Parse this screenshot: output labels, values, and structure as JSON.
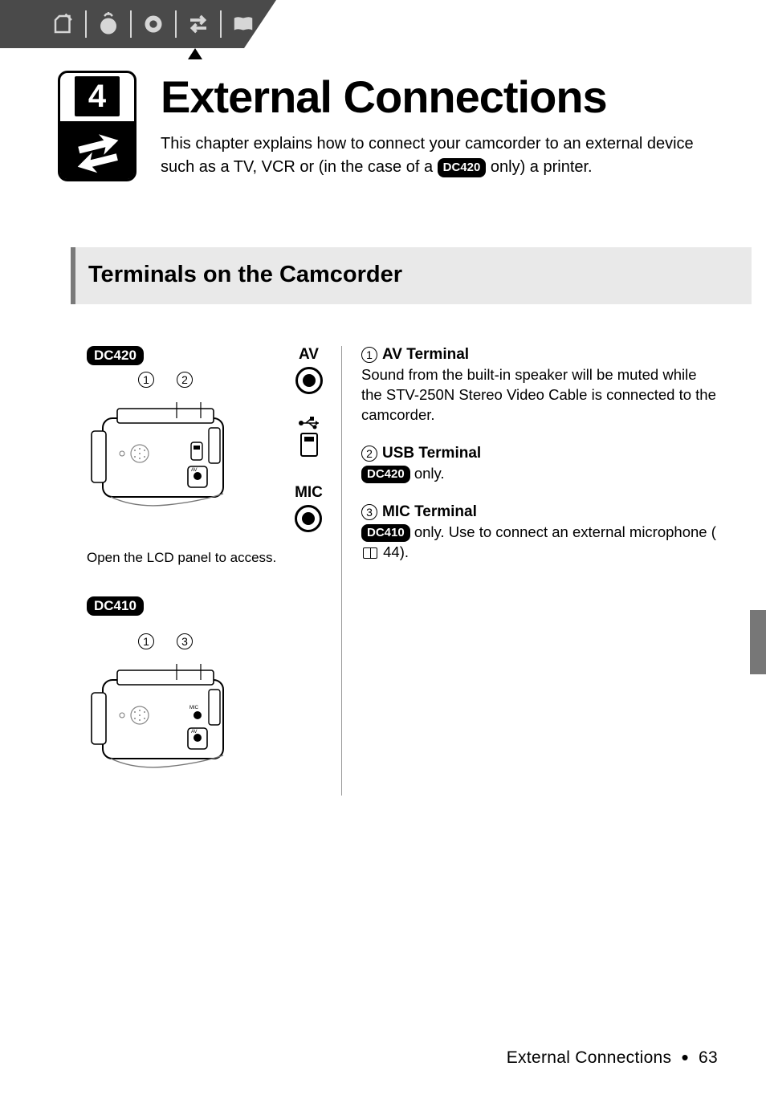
{
  "chapter": {
    "number": "4",
    "title": "External Connections",
    "desc_prefix": "This chapter explains how to connect your camcorder to an external device such as a TV, VCR or (in the case of a ",
    "desc_model": "DC420",
    "desc_suffix": " only) a printer."
  },
  "section": {
    "title": "Terminals on the Camcorder"
  },
  "left": {
    "model1": "DC420",
    "model2": "DC410",
    "diagram1_callouts": [
      "1",
      "2"
    ],
    "diagram2_callouts": [
      "1",
      "3"
    ],
    "caption": "Open the LCD panel to access."
  },
  "center": {
    "av_label": "AV",
    "mic_label": "MIC"
  },
  "terminals": [
    {
      "num": "1",
      "name": "AV Terminal",
      "body": "Sound from the built-in speaker will be muted while the STV-250N Stereo Video Cable is connected to the camcorder."
    },
    {
      "num": "2",
      "name": "USB Terminal",
      "model": "DC420",
      "body_suffix": " only."
    },
    {
      "num": "3",
      "name": "MIC Terminal",
      "model": "DC410",
      "body_mid": " only. Use to connect an external microphone (",
      "page_ref": " 44).",
      "body_suffix": ""
    }
  ],
  "footer": {
    "text": "External Connections",
    "page": "63"
  }
}
